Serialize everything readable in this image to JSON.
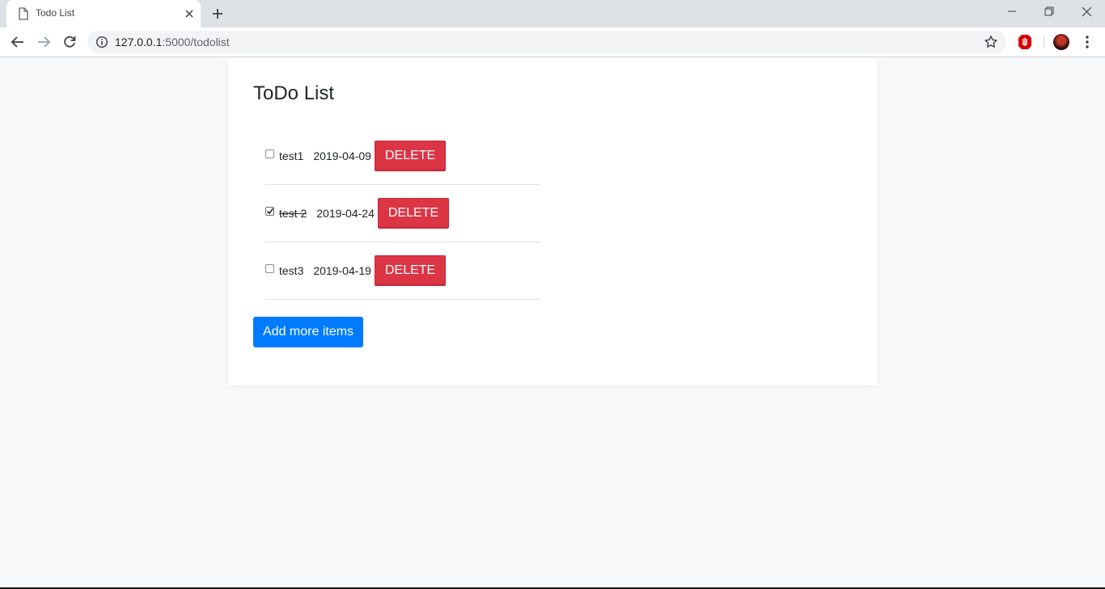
{
  "browser": {
    "tab_title": "Todo List",
    "url_host": "127.0.0.1",
    "url_path": ":5000/todolist"
  },
  "page": {
    "title": "ToDo List",
    "add_button_label": "Add more items",
    "delete_label": "DELETE"
  },
  "todos": [
    {
      "name": "test1",
      "date": "2019-04-09",
      "done": false
    },
    {
      "name": "test 2",
      "date": "2019-04-24",
      "done": true
    },
    {
      "name": "test3",
      "date": "2019-04-19",
      "done": false
    }
  ],
  "icons": {
    "tab": "page-icon",
    "close": "close-icon",
    "new_tab": "plus-icon",
    "back": "back-arrow-icon",
    "forward": "forward-arrow-icon",
    "reload": "reload-icon",
    "info": "info-icon",
    "bookmark": "star-icon",
    "extension": "adblock-icon",
    "menu": "kebab-menu-icon"
  },
  "colors": {
    "delete": "#dc3545",
    "primary": "#007bff",
    "page_bg": "#f8f9fa"
  }
}
